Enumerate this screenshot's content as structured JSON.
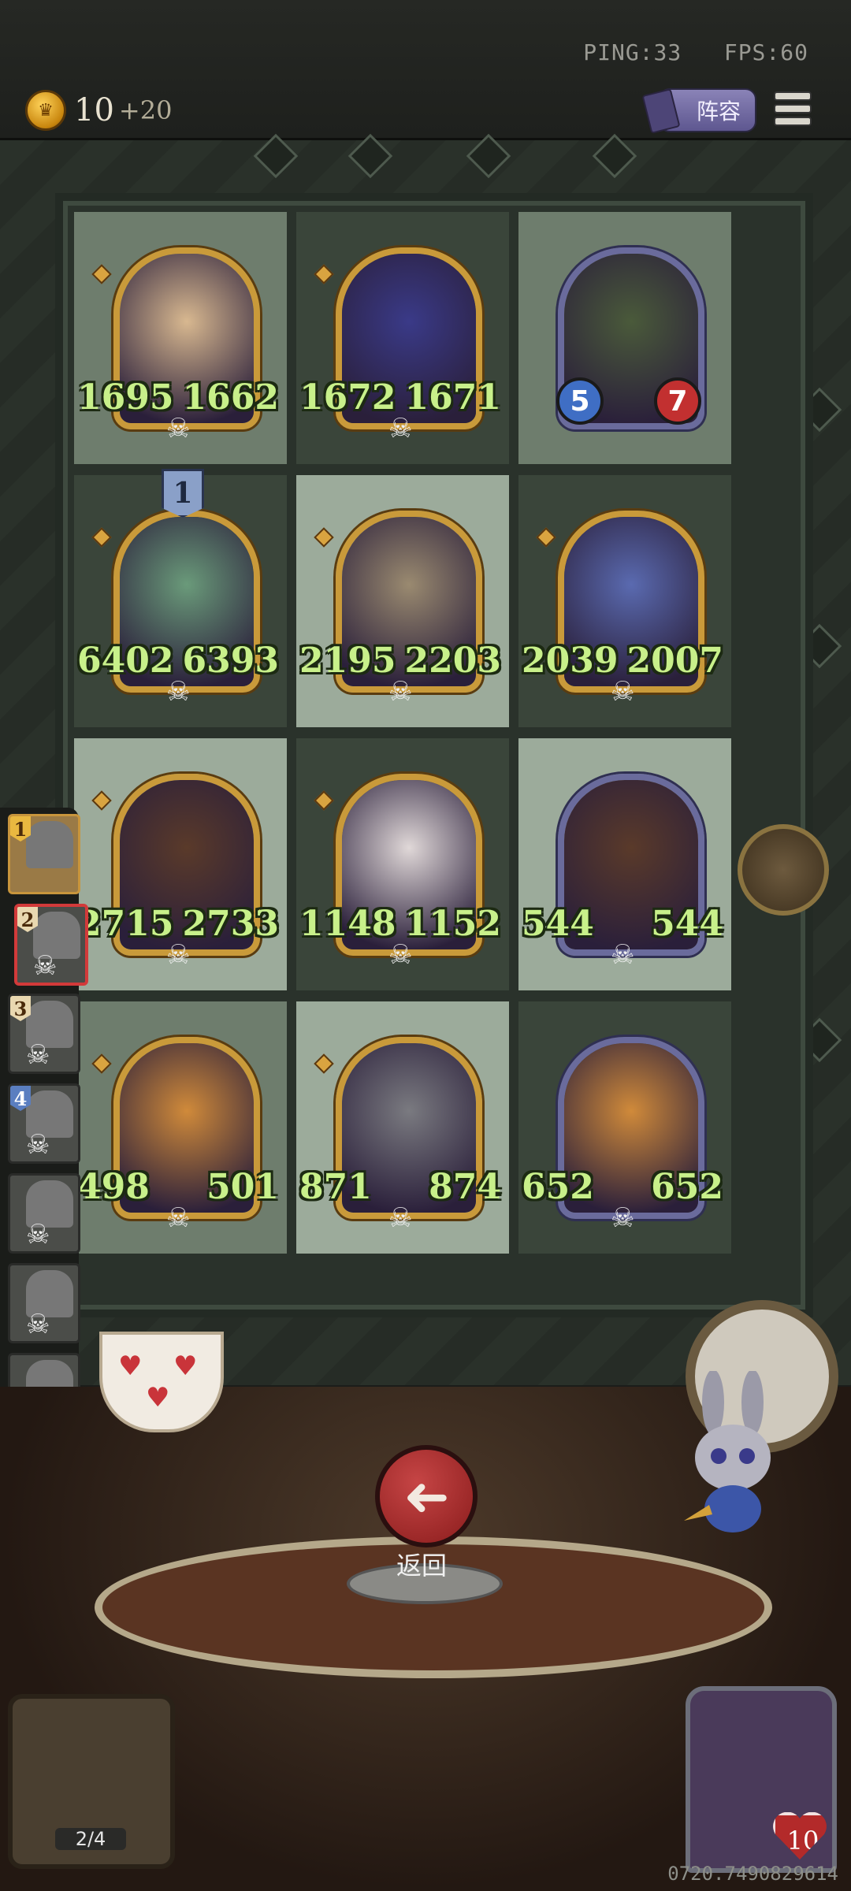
{
  "hud": {
    "ping": "PING:33",
    "fps": "FPS:60",
    "coins": "10",
    "coin_bonus": "+20",
    "lineup_label": "阵容"
  },
  "board": {
    "rows": [
      [
        {
          "atk": "1695",
          "hp": "1662",
          "bg": "mid",
          "frame": "gold",
          "badge": false
        },
        {
          "atk": "1672",
          "hp": "1671",
          "bg": "dark",
          "frame": "gold",
          "badge": false
        },
        {
          "atk": "5",
          "hp": "7",
          "bg": "mid",
          "frame": "purple",
          "badge": true
        }
      ],
      [
        {
          "atk": "6402",
          "hp": "6393",
          "bg": "dark",
          "frame": "gold",
          "badge": false,
          "tier": "1"
        },
        {
          "atk": "2195",
          "hp": "2203",
          "bg": "light",
          "frame": "gold",
          "badge": false
        },
        {
          "atk": "2039",
          "hp": "2007",
          "bg": "dark",
          "frame": "gold",
          "badge": false
        }
      ],
      [
        {
          "atk": "2715",
          "hp": "2733",
          "bg": "light",
          "frame": "gold",
          "badge": false
        },
        {
          "atk": "1148",
          "hp": "1152",
          "bg": "dark",
          "frame": "gold",
          "badge": false
        },
        {
          "atk": "544",
          "hp": "544",
          "bg": "light",
          "frame": "purple",
          "badge": false
        }
      ],
      [
        {
          "atk": "498",
          "hp": "501",
          "bg": "mid",
          "frame": "gold",
          "badge": false
        },
        {
          "atk": "871",
          "hp": "874",
          "bg": "light",
          "frame": "gold",
          "badge": false
        },
        {
          "atk": "652",
          "hp": "652",
          "bg": "dark",
          "frame": "purple",
          "badge": false
        }
      ]
    ]
  },
  "players": [
    {
      "rank": "1",
      "style": "gold"
    },
    {
      "rank": "2",
      "style": "white"
    },
    {
      "rank": "3",
      "style": "white"
    },
    {
      "rank": "4",
      "style": "blue"
    },
    {
      "rank": "",
      "style": "none"
    },
    {
      "rank": "",
      "style": "none"
    },
    {
      "rank": "",
      "style": "none"
    },
    {
      "rank": "",
      "style": "none"
    }
  ],
  "back_label": "返回",
  "treasure_count": "2/4",
  "hero_hp": "10",
  "session_id": "0720.7490829614",
  "colors": {
    "stat_green": "#c8f08a",
    "back_red": "#c64545"
  },
  "icons": {
    "skull": "skull-icon",
    "back": "arrow-left-icon",
    "menu": "hamburger-icon",
    "coin": "coin-icon"
  }
}
